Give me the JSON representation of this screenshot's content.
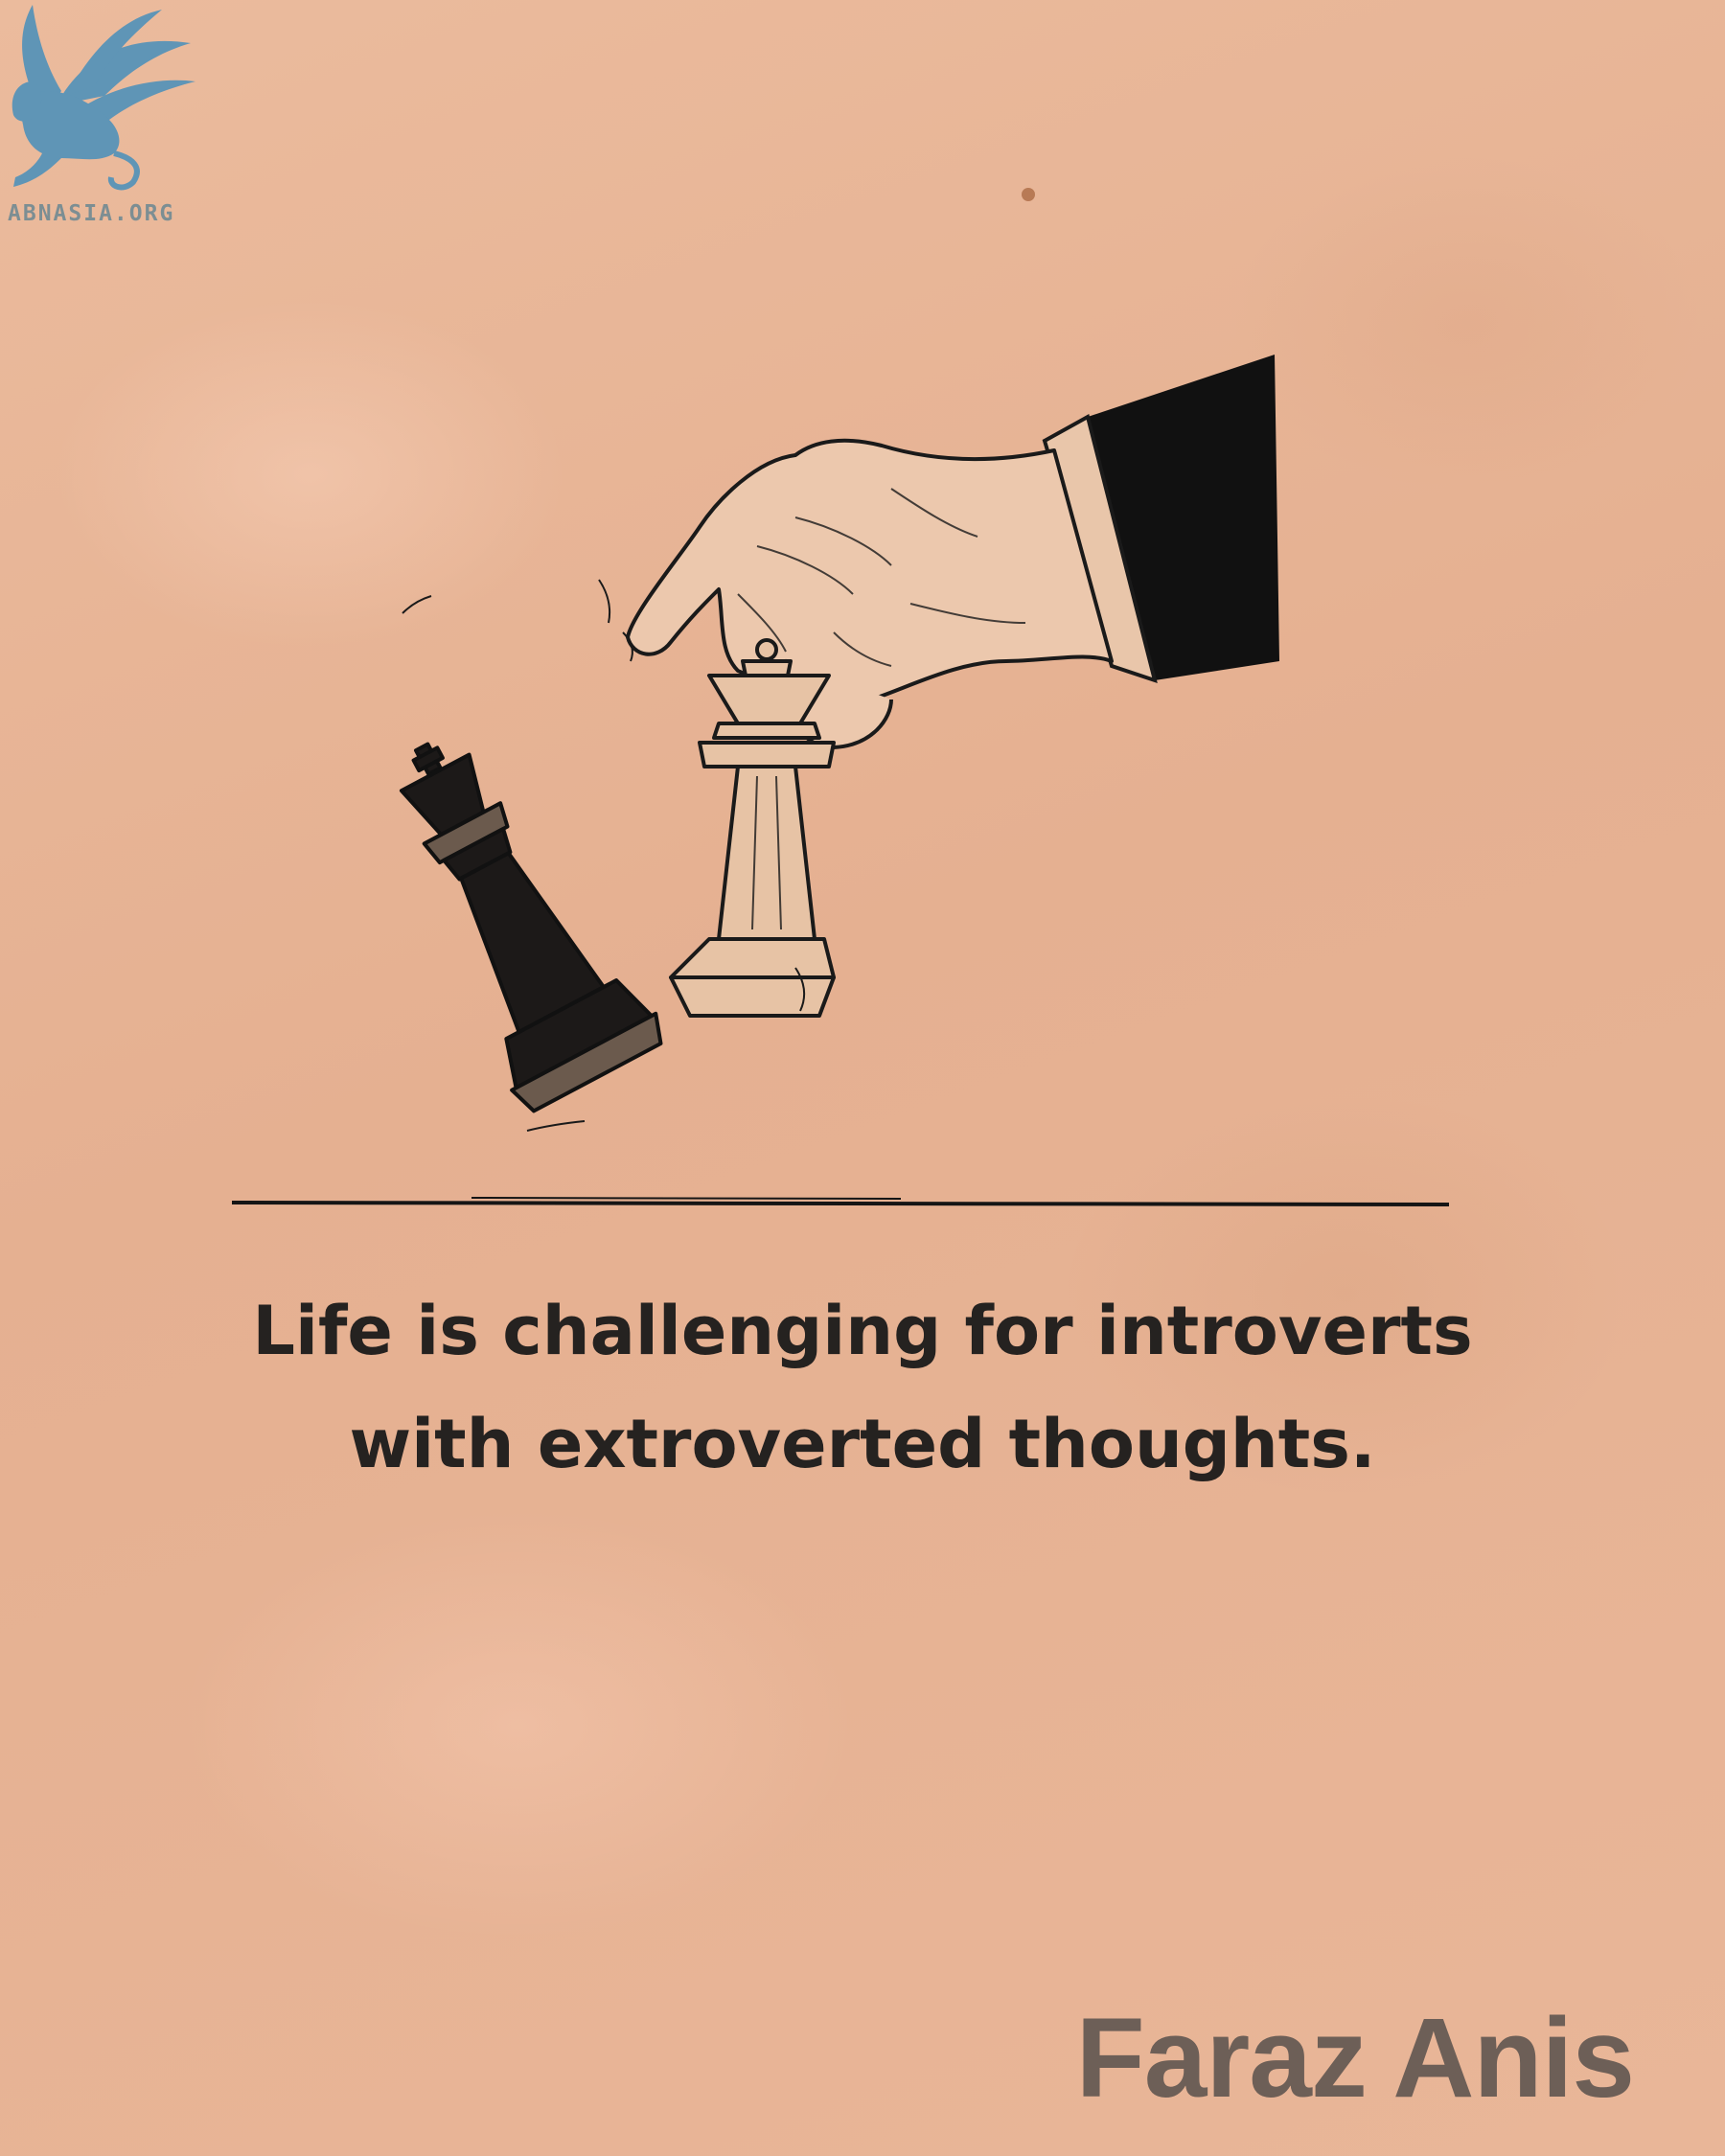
{
  "logo": {
    "text": "ABNASIA.ORG",
    "icon": "winged-lion-icon",
    "color": "#5f95b6"
  },
  "illustration": {
    "description_icon": "hand-moving-chess-queen-icon",
    "pieces": [
      "white-queen-icon",
      "black-king-icon"
    ]
  },
  "quote": {
    "line1": "Life is challenging for introverts",
    "line2": "with extroverted thoughts."
  },
  "author": "Faraz Anis",
  "colors": {
    "background": "#e8b596",
    "quote_text": "#252220",
    "author_text": "#6d5f57"
  }
}
